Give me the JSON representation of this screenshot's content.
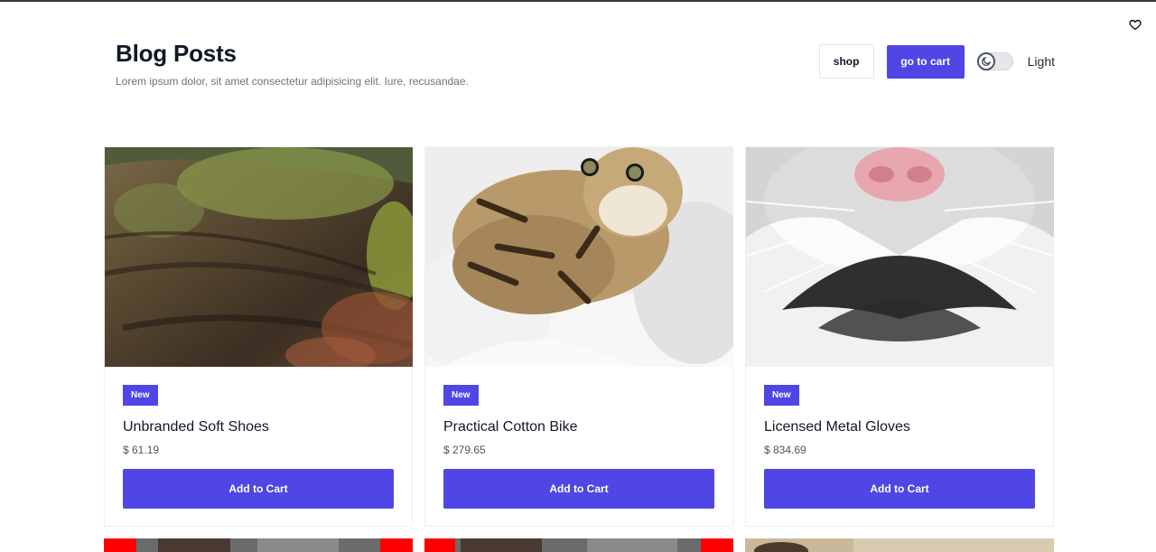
{
  "header": {
    "title": "Blog Posts",
    "subtitle": "Lorem ipsum dolor, sit amet consectetur adipisicing elit. Iure, recusandae."
  },
  "actions": {
    "shop_label": "shop",
    "cart_label": "go to cart",
    "theme_label": "Light"
  },
  "colors": {
    "accent": "#4f46e5"
  },
  "products": [
    {
      "badge": "New",
      "name": "Unbranded Soft Shoes",
      "price": "$ 61.19",
      "button": "Add to Cart",
      "image": "mossy-log-photo"
    },
    {
      "badge": "New",
      "name": "Practical Cotton Bike",
      "price": "$ 279.65",
      "button": "Add to Cart",
      "image": "tabby-kitten-photo"
    },
    {
      "badge": "New",
      "name": "Licensed Metal Gloves",
      "price": "$ 834.69",
      "button": "Add to Cart",
      "image": "cat-nose-closeup-photo"
    }
  ],
  "icons": {
    "favorite": "heart-icon",
    "theme": "moon-icon"
  }
}
